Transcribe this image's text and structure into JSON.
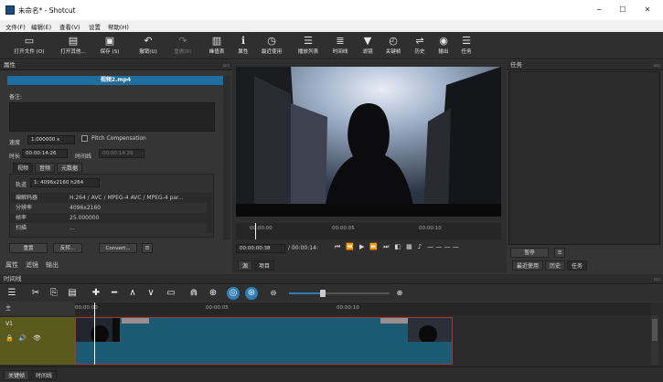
{
  "window": {
    "title": "未命名* - Shotcut",
    "min": "–",
    "max": "☐",
    "close": "✕"
  },
  "menu": [
    "文件(F)",
    "编辑(E)",
    "查看(V)",
    "设置",
    "帮助(H)"
  ],
  "toolbar": [
    {
      "label": "打开文件 (O)",
      "icon": "folder-icon",
      "glyph": "▭"
    },
    {
      "label": "打开其他...",
      "icon": "film-open-icon",
      "glyph": "▤"
    },
    {
      "label": "保存 (S)",
      "icon": "save-icon",
      "glyph": "▣"
    },
    {
      "label": "撤销(U)",
      "icon": "undo-icon",
      "glyph": "↶"
    },
    {
      "label": "重做(R)",
      "icon": "redo-icon",
      "glyph": "↷"
    },
    {
      "label": "峰值表",
      "icon": "peak-meter-icon",
      "glyph": "▥"
    },
    {
      "label": "属性",
      "icon": "info-icon",
      "glyph": "ℹ"
    },
    {
      "label": "最近使用",
      "icon": "clock-icon",
      "glyph": "◷"
    },
    {
      "label": "播放列表",
      "icon": "playlist-icon",
      "glyph": "☰"
    },
    {
      "label": "时间线",
      "icon": "timeline-icon",
      "glyph": "≣"
    },
    {
      "label": "滤镜",
      "icon": "filter-icon",
      "glyph": "▼"
    },
    {
      "label": "关键帧",
      "icon": "stopwatch-icon",
      "glyph": "◴"
    },
    {
      "label": "历史",
      "icon": "history-icon",
      "glyph": "⇌"
    },
    {
      "label": "输出",
      "icon": "export-icon",
      "glyph": "◉"
    },
    {
      "label": "任务",
      "icon": "jobs-icon",
      "glyph": "☰"
    }
  ],
  "properties": {
    "title": "属性",
    "clip_name": "视频2.mp4",
    "notes_label": "备注:",
    "speed_label": "速度",
    "speed_value": "1.000000 x",
    "pitch_label": "Pitch Compensation",
    "duration_label": "时长",
    "duration_value": "00:00:14:26",
    "timeline_label": "时间线",
    "timeline_value": "00:00:14:26",
    "tabs": [
      "视频",
      "音频",
      "元数据"
    ],
    "track_label": "轨道",
    "track_value": "1: 4096x2160 h264",
    "rows": [
      {
        "k": "编解码器",
        "v": "H.264 / AVC / MPEG-4 AVC / MPEG-4 par..."
      },
      {
        "k": "分辨率",
        "v": "4096x2160"
      },
      {
        "k": "帧率",
        "v": "25.000000"
      },
      {
        "k": "扫描",
        "v": "..."
      }
    ],
    "buttons": [
      "重置",
      "反转...",
      "Convert...",
      "☰"
    ]
  },
  "bottom_tabs_left": [
    "属性",
    "滤镜",
    "输出"
  ],
  "player": {
    "ruler": [
      "00:00:00",
      "00:00:05",
      "00:00:10"
    ],
    "position": "00:00:00:38",
    "duration": "/ 00:00:14:",
    "tabs": [
      "源",
      "项目"
    ],
    "controls": [
      "⏮",
      "⏪",
      "▶",
      "⏩",
      "⏭",
      "◧",
      "▦",
      "♪",
      "— — — —"
    ]
  },
  "jobs": {
    "title": "任务",
    "pause": "暂停",
    "menu": "☰",
    "tabs": [
      "最近使用",
      "历史",
      "任务"
    ]
  },
  "timeline": {
    "title": "时间线",
    "track_header": "主",
    "track_name": "V1",
    "ruler": [
      "00:00:00",
      "00:00:05",
      "00:00:10"
    ],
    "tools": [
      "☰",
      "✂",
      "⎘",
      "▤",
      "✚",
      "━",
      "∧",
      "∨",
      "▭",
      "⋒",
      "⊕",
      "◎",
      "⊛",
      "🔍"
    ],
    "bottom_tabs": [
      "关键帧",
      "时间线"
    ]
  },
  "colors": {
    "accent": "#1f6ea0",
    "track": "#1a5b73",
    "track_header": "#5a5a1c",
    "playhead": "#ffffff"
  }
}
